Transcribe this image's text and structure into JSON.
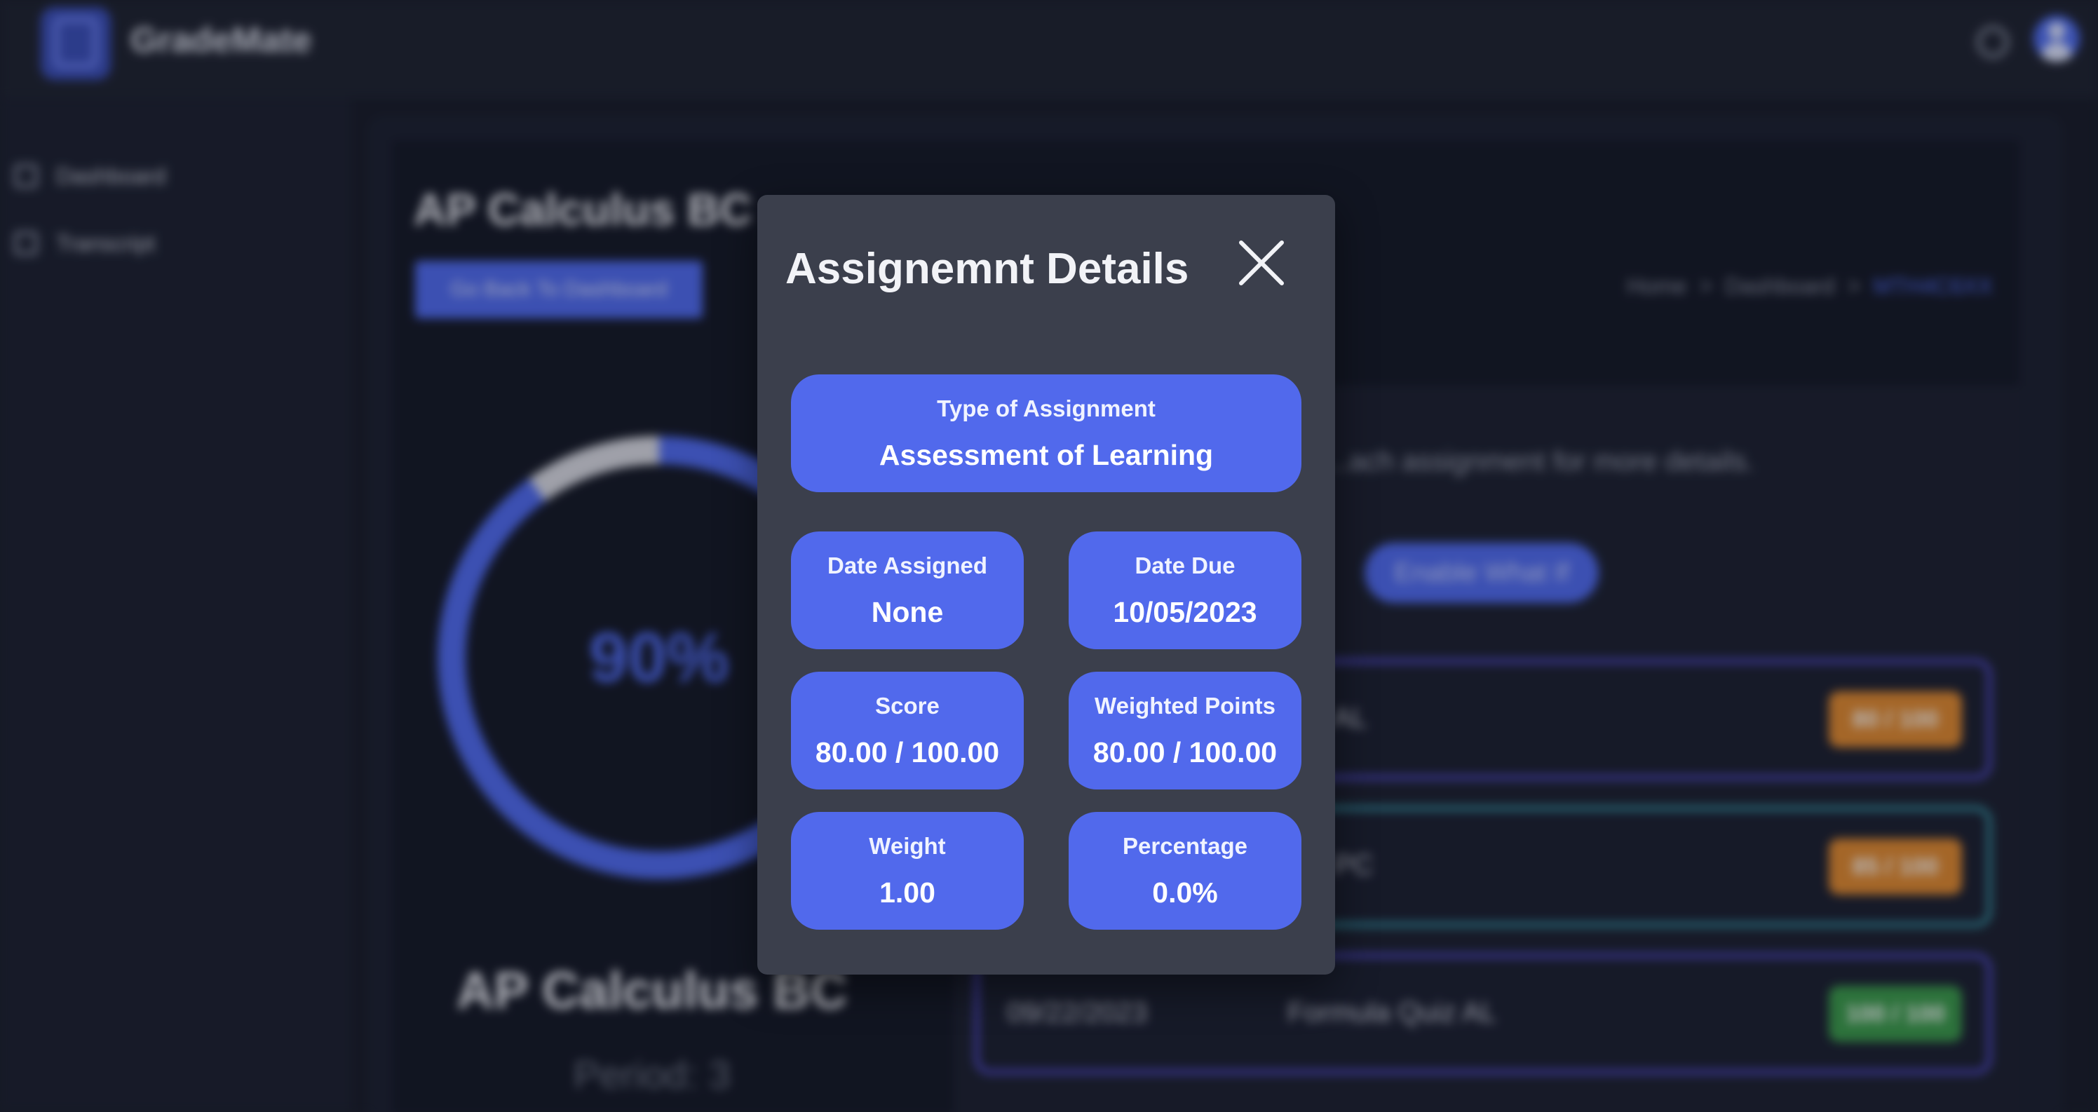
{
  "app": {
    "brand": "GradeMate",
    "sidebar": {
      "items": [
        {
          "label": "Dashboard",
          "icon": "dashboard-icon"
        },
        {
          "label": "Transcript",
          "icon": "transcript-icon"
        }
      ]
    }
  },
  "course": {
    "title": "AP Calculus BC",
    "back_button": "Go Back To Dashboard",
    "breadcrumb": [
      "Home",
      ">",
      "Dashboard",
      ">",
      "MTH4C6XX"
    ],
    "grade_percent": 90,
    "grade_label": "90%",
    "subtitle": "AP Calculus BC",
    "period": "Period: 3"
  },
  "assignments_panel": {
    "hint": "...ach assignment for more details.",
    "whatif_button": "Enable What If",
    "rows": [
      {
        "date": "",
        "name": "...3 AL",
        "score": "80 / 100",
        "score_color": "#e08a30",
        "border": "#5850e0"
      },
      {
        "date": "",
        "name": "...3 PC",
        "score": "85 / 100",
        "score_color": "#e08a30",
        "border": "#3aa7b8"
      },
      {
        "date": "09/22/2023",
        "name": "Formula Quiz AL",
        "score": "100 / 100",
        "score_color": "#3a9a4a",
        "border": "#5850e0"
      }
    ]
  },
  "modal": {
    "title": "Assignemnt Details",
    "close_icon": "close-icon",
    "type": {
      "label": "Type of Assignment",
      "value": "Assessment of Learning"
    },
    "date_assigned": {
      "label": "Date Assigned",
      "value": "None"
    },
    "date_due": {
      "label": "Date Due",
      "value": "10/05/2023"
    },
    "score": {
      "label": "Score",
      "value": "80.00 / 100.00"
    },
    "weighted_points": {
      "label": "Weighted Points",
      "value": "80.00 / 100.00"
    },
    "weight": {
      "label": "Weight",
      "value": "1.00"
    },
    "percentage": {
      "label": "Percentage",
      "value": "0.0%"
    }
  },
  "colors": {
    "accent": "#5169ec",
    "modal_bg": "#3b3f4c",
    "page_bg": "#1a1f2b"
  }
}
